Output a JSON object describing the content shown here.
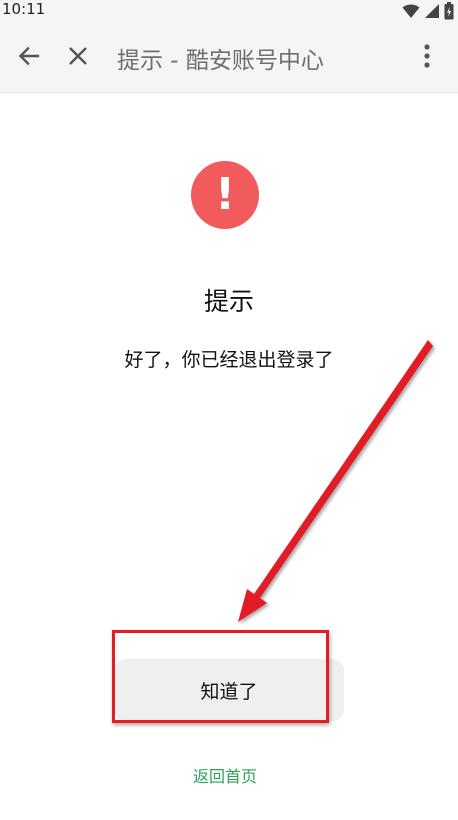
{
  "status_bar": {
    "time": "10:11",
    "icons": [
      "wifi-icon",
      "cellular-signal-icon",
      "battery-icon"
    ]
  },
  "app_bar": {
    "title": "提示 - 酷安账号中心",
    "icons": [
      "back-arrow-icon",
      "close-icon",
      "more-vert-icon"
    ]
  },
  "dialog": {
    "icon": "exclamation-icon",
    "icon_symbol": "!",
    "icon_color": "#f15b5b",
    "title": "提示",
    "message": "好了，你已经退出登录了",
    "confirm_label": "知道了",
    "home_link": "返回首页"
  },
  "colors": {
    "link": "#2aa35a",
    "annotation": "#e21d25"
  }
}
